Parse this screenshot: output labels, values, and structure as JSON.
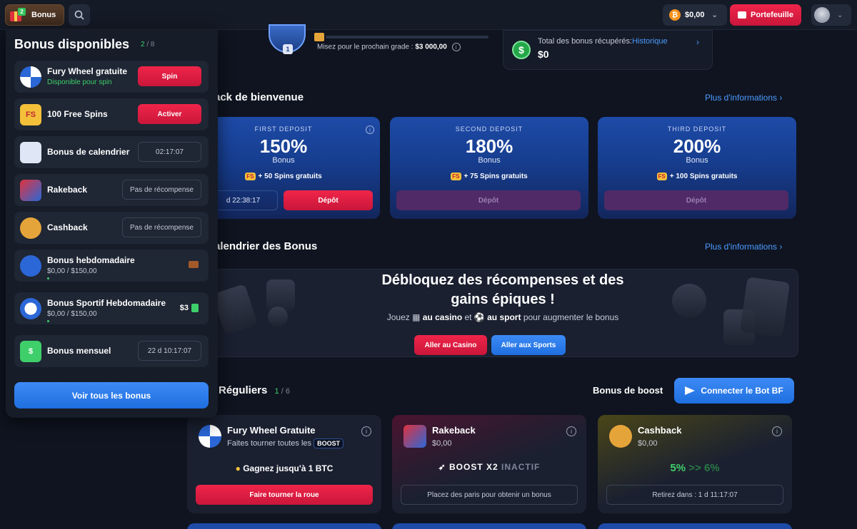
{
  "topbar": {
    "bonus_label": "Bonus",
    "bonus_badge": "2",
    "balance": "$0,00",
    "wallet_label": "Portefeuille"
  },
  "rank": {
    "level": "1",
    "progress_text": "Misez pour le prochain grade :",
    "progress_amount": "$3 000,00"
  },
  "recovered": {
    "label": "Total des bonus récupérés:",
    "link": "Historique",
    "value": "$0"
  },
  "welcome": {
    "title": "ack de bienvenue",
    "more": "Plus d'informations",
    "cards": [
      {
        "head": "FIRST DEPOSIT",
        "pct": "150%",
        "bonus": "Bonus",
        "spins": "+ 50 Spins gratuits",
        "timer": "d 22:38:17",
        "button": "Dépôt"
      },
      {
        "head": "SECOND DEPOSIT",
        "pct": "180%",
        "bonus": "Bonus",
        "spins": "+ 75 Spins gratuits",
        "button": "Dépôt"
      },
      {
        "head": "THIRD DEPOSIT",
        "pct": "200%",
        "bonus": "Bonus",
        "spins": "+ 100 Spins gratuits",
        "button": "Dépôt"
      }
    ]
  },
  "calendar": {
    "title": "alendrier des Bonus",
    "more": "Plus d'informations",
    "banner_line1": "Débloquez des récompenses et des",
    "banner_line2": "gains épiques !",
    "sub_pre": "Jouez",
    "sub_casino": "au casino",
    "sub_mid": "et",
    "sub_sport": "au sport",
    "sub_post": "pour augmenter le bonus",
    "casino_btn": "Aller au Casino",
    "sports_btn": "Aller aux Sports"
  },
  "regular": {
    "title": "Réguliers",
    "count_current": "1",
    "count_total": "/ 6",
    "boost_label": "Bonus de boost",
    "bot_btn": "Connecter le Bot BF",
    "cards": [
      {
        "title": "Fury Wheel Gratuite",
        "sub": "Faites tourner toutes les",
        "boost_tag": "BOOST",
        "mid": "Gagnez jusqu'à 1 BTC",
        "button": "Faire tourner la roue"
      },
      {
        "title": "Rakeback",
        "sub": "$0,00",
        "mid": "BOOST X2",
        "mid_status": "INACTIF",
        "button": "Placez des paris pour obtenir un bonus"
      },
      {
        "title": "Cashback",
        "sub": "$0,00",
        "pct_from": "5%",
        "arrow": ">>",
        "pct_to": "6%",
        "button": "Retirez dans : 1 d 11:17:07"
      }
    ]
  },
  "panel": {
    "title": "Bonus disponibles",
    "count_current": "2",
    "count_total": "/ 8",
    "items": [
      {
        "name": "Fury Wheel gratuite",
        "sub": "Disponible pour spin",
        "action": "Spin"
      },
      {
        "name": "100 Free Spins",
        "action": "Activer"
      },
      {
        "name": "Bonus de calendrier",
        "action": "02:17:07"
      },
      {
        "name": "Rakeback",
        "action": "Pas de récompense"
      },
      {
        "name": "Cashback",
        "action": "Pas de récompense"
      },
      {
        "name": "Bonus hebdomadaire",
        "sub": "$0,00 / $150,00"
      },
      {
        "name": "Bonus Sportif Hebdomadaire",
        "sub": "$0,00 / $150,00",
        "right": "$3"
      },
      {
        "name": "Bonus mensuel",
        "action": "22 d 10:17:07"
      }
    ],
    "see_all": "Voir tous les bonus"
  }
}
